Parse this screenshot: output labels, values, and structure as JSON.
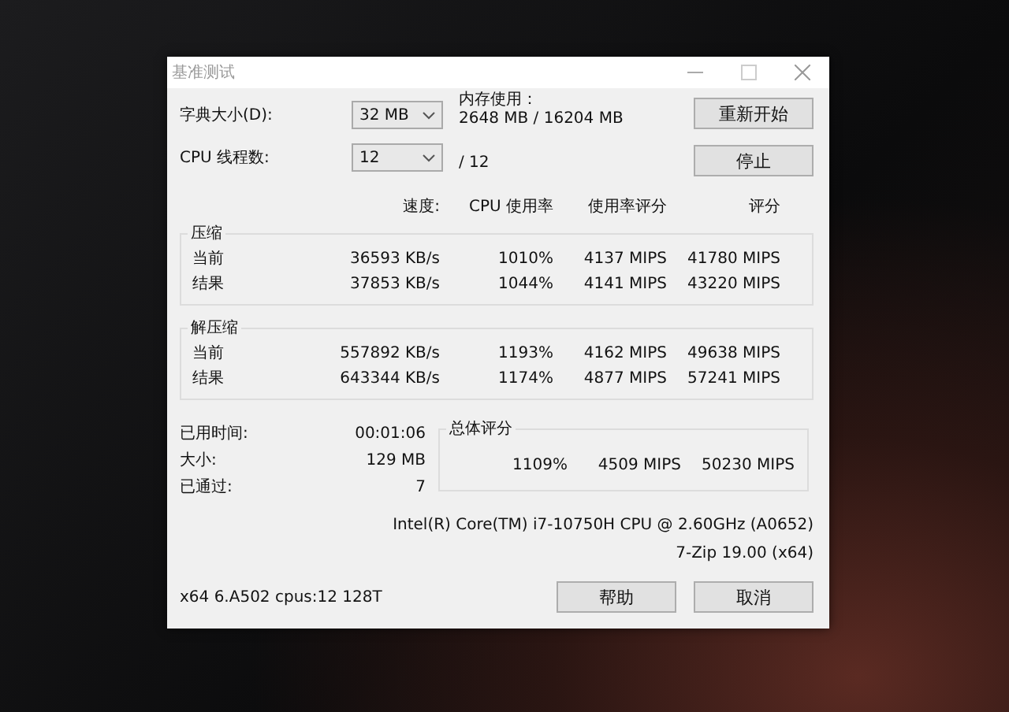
{
  "window": {
    "title": "基准测试"
  },
  "settings": [
    {
      "label": "字典大小(D):",
      "value": "32 MB"
    },
    {
      "label": "CPU 线程数:",
      "value": "12"
    }
  ],
  "memory": {
    "label": "内存使用：",
    "value": "2648 MB / 16204 MB"
  },
  "threads_total": "/ 12",
  "action_buttons": [
    "重新开始",
    "停止"
  ],
  "columns": [
    "速度:",
    "CPU 使用率",
    "使用率评分",
    "评分"
  ],
  "groups": [
    {
      "title": "压缩",
      "rows": [
        {
          "label": "当前",
          "cells": [
            "36593 KB/s",
            "1010%",
            "4137 MIPS",
            "41780 MIPS"
          ]
        },
        {
          "label": "结果",
          "cells": [
            "37853 KB/s",
            "1044%",
            "4141 MIPS",
            "43220 MIPS"
          ]
        }
      ]
    },
    {
      "title": "解压缩",
      "rows": [
        {
          "label": "当前",
          "cells": [
            "557892 KB/s",
            "1193%",
            "4162 MIPS",
            "49638 MIPS"
          ]
        },
        {
          "label": "结果",
          "cells": [
            "643344 KB/s",
            "1174%",
            "4877 MIPS",
            "57241 MIPS"
          ]
        }
      ]
    }
  ],
  "stats": [
    {
      "label": "已用时间:",
      "value": "00:01:06"
    },
    {
      "label": "大小:",
      "value": "129 MB"
    },
    {
      "label": "已通过:",
      "value": "7"
    }
  ],
  "overall": {
    "title": "总体评分",
    "cells": [
      "1109%",
      "4509 MIPS",
      "50230 MIPS"
    ]
  },
  "cpu_info": "Intel(R) Core(TM) i7-10750H CPU @ 2.60GHz (A0652)",
  "version": "7-Zip 19.00 (x64)",
  "system_info": "x64 6.A502 cpus:12 128T",
  "buttons": [
    "帮助",
    "取消"
  ]
}
